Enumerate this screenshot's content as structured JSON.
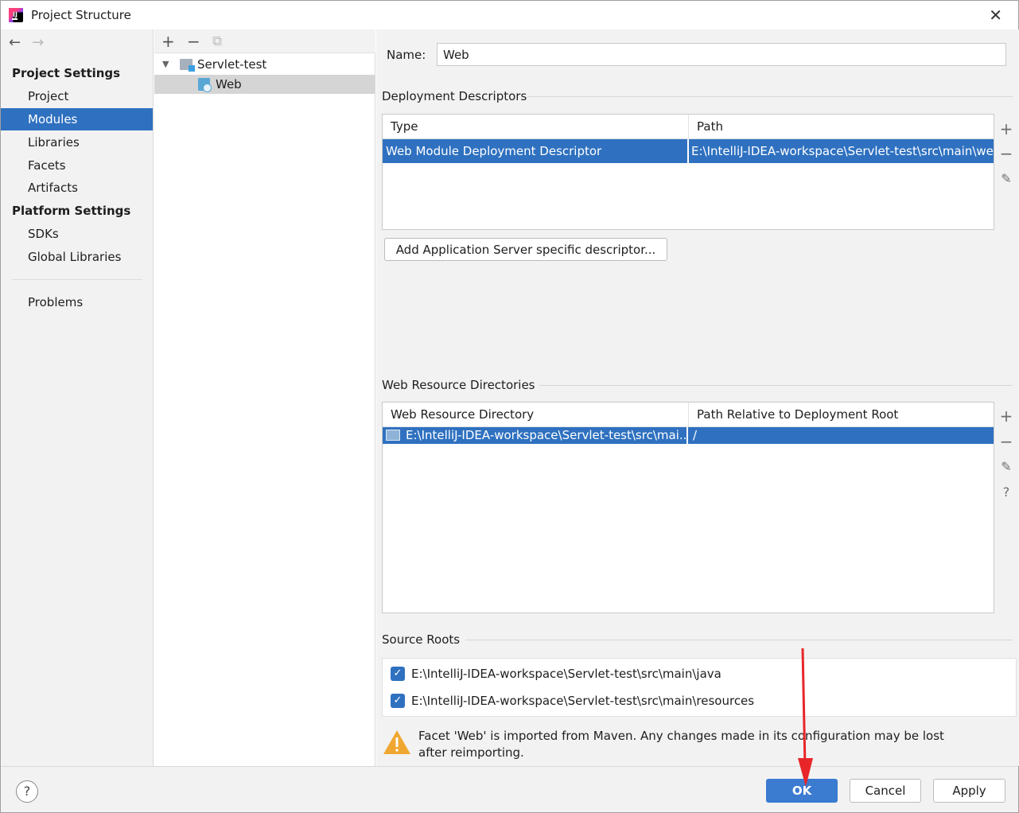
{
  "window": {
    "title": "Project Structure"
  },
  "nav": {
    "back": "←",
    "forward": "→"
  },
  "sidebar": {
    "project_settings": "Project Settings",
    "items_project": [
      {
        "label": "Project"
      },
      {
        "label": "Modules"
      },
      {
        "label": "Libraries"
      },
      {
        "label": "Facets"
      },
      {
        "label": "Artifacts"
      }
    ],
    "platform_settings": "Platform Settings",
    "items_platform": [
      {
        "label": "SDKs"
      },
      {
        "label": "Global Libraries"
      }
    ],
    "problems": "Problems"
  },
  "tree": {
    "toolbar": {
      "add": "+",
      "remove": "−",
      "copy": "⧉"
    },
    "root": "Servlet-test",
    "child": "Web"
  },
  "facet": {
    "name_label": "Name:",
    "name_value": "Web",
    "deployment_descriptors": {
      "title": "Deployment Descriptors",
      "columns": [
        "Type",
        "Path"
      ],
      "rows": [
        {
          "type": "Web Module Deployment Descriptor",
          "path": "E:\\IntelliJ-IDEA-workspace\\Servlet-test\\src\\main\\we"
        }
      ],
      "add_server_button": "Add Application Server specific descriptor..."
    },
    "web_resource_directories": {
      "title": "Web Resource Directories",
      "columns": [
        "Web Resource Directory",
        "Path Relative to Deployment Root"
      ],
      "rows": [
        {
          "directory": "E:\\IntelliJ-IDEA-workspace\\Servlet-test\\src\\mai...",
          "relative": "/"
        }
      ]
    },
    "source_roots": {
      "title": "Source Roots",
      "items": [
        {
          "path": "E:\\IntelliJ-IDEA-workspace\\Servlet-test\\src\\main\\java",
          "checked": true
        },
        {
          "path": "E:\\IntelliJ-IDEA-workspace\\Servlet-test\\src\\main\\resources",
          "checked": true
        }
      ]
    },
    "warning": "Facet 'Web' is imported from Maven. Any changes made in its configuration may be lost after reimporting."
  },
  "tools": {
    "add": "+",
    "remove": "−",
    "edit": "✎",
    "help": "?"
  },
  "buttons": {
    "help": "?",
    "ok": "OK",
    "cancel": "Cancel",
    "apply": "Apply"
  },
  "colors": {
    "selection": "#2f71c0",
    "ok_button": "#3b7bd0",
    "annotation_arrow": "#e8262a"
  }
}
